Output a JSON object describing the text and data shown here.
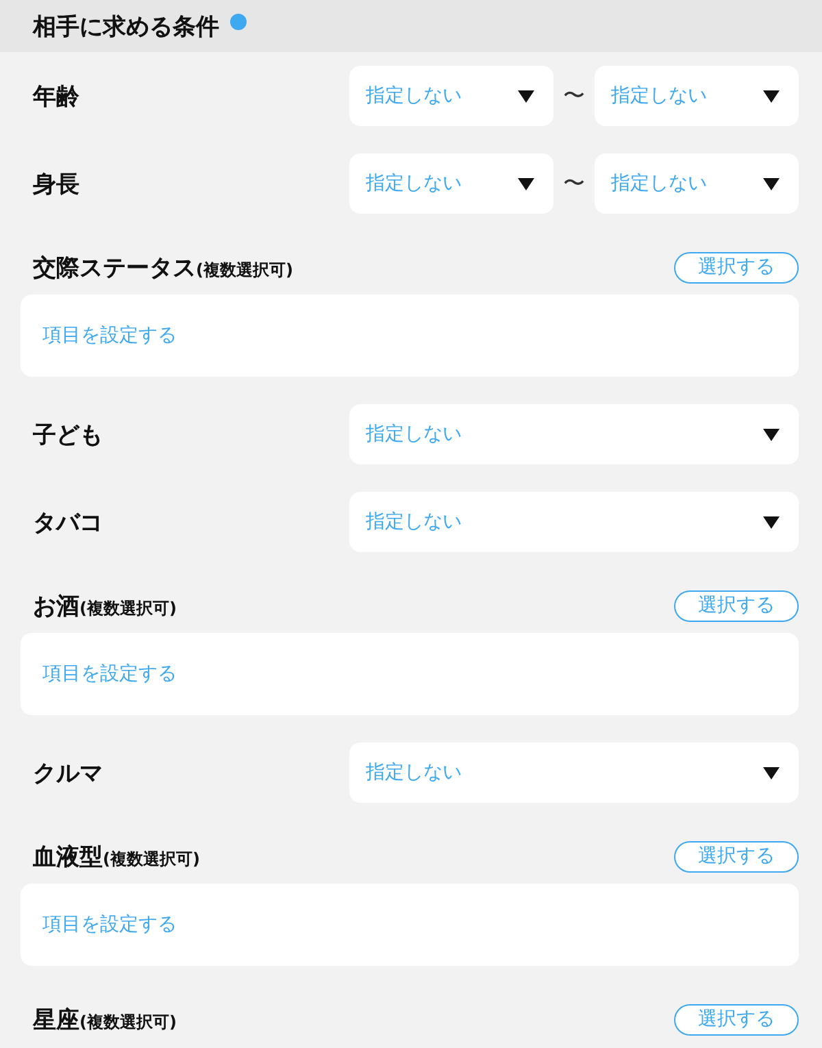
{
  "header": {
    "title": "相手に求める条件"
  },
  "conditions": [
    {
      "kind": "range",
      "label": "年齢",
      "from": "指定しない",
      "separator": "〜",
      "to": "指定しない"
    },
    {
      "kind": "range",
      "label": "身長",
      "from": "指定しない",
      "separator": "〜",
      "to": "指定しない"
    },
    {
      "kind": "multi",
      "label": "交際ステータス",
      "note": "(複数選択可)",
      "button": "選択する",
      "prompt": "項目を設定する"
    },
    {
      "kind": "select",
      "label": "子ども",
      "value": "指定しない"
    },
    {
      "kind": "select",
      "label": "タバコ",
      "value": "指定しない"
    },
    {
      "kind": "multi",
      "label": "お酒",
      "note": "(複数選択可)",
      "button": "選択する",
      "prompt": "項目を設定する"
    },
    {
      "kind": "select",
      "label": "クルマ",
      "value": "指定しない"
    },
    {
      "kind": "multi",
      "label": "血液型",
      "note": "(複数選択可)",
      "button": "選択する",
      "prompt": "項目を設定する"
    },
    {
      "kind": "multi",
      "label": "星座",
      "note": "(複数選択可)",
      "button": "選択する"
    }
  ]
}
